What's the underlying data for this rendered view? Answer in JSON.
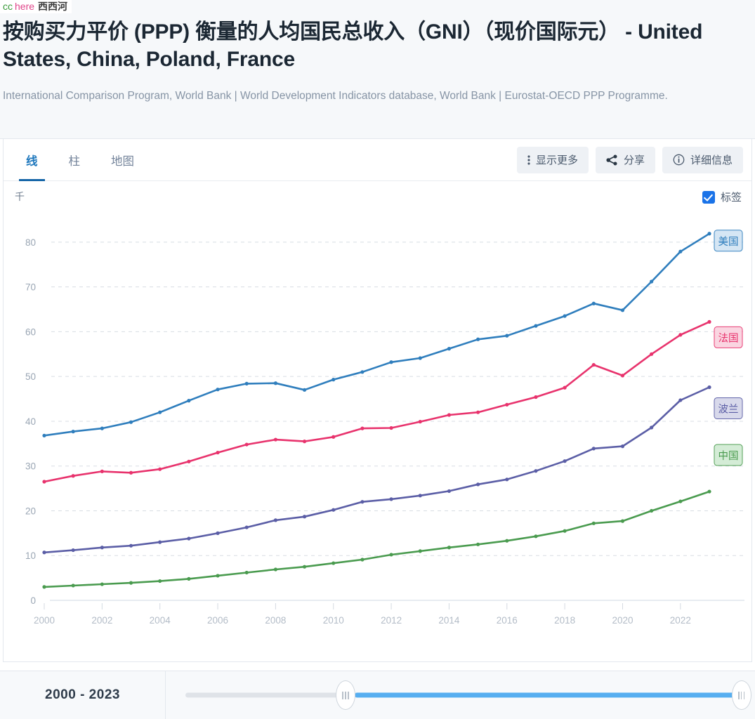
{
  "watermark": {
    "cc": "cc",
    "here": "here",
    "site": "西西河"
  },
  "header": {
    "title": "按购买力平价 (PPP) 衡量的人均国民总收入（GNI）（现价国际元） - United States, China, Poland, France",
    "subtitle": "International Comparison Program, World Bank | World Development Indicators database, World Bank | Eurostat-OECD PPP Programme."
  },
  "tabs": [
    {
      "label": "线",
      "active": true
    },
    {
      "label": "柱",
      "active": false
    },
    {
      "label": "地图",
      "active": false
    }
  ],
  "toolbar": {
    "show_more": "显示更多",
    "share": "分享",
    "details": "详细信息"
  },
  "chart_controls": {
    "labels_checkbox": "标签",
    "labels_checked": true,
    "unit": "千"
  },
  "footer": {
    "range_text": "2000 - 2023",
    "slider_start": 2000,
    "slider_end": 2023
  },
  "chart_data": {
    "type": "line",
    "title": "按购买力平价 (PPP) 衡量的人均国民总收入（GNI）（现价国际元）",
    "xlabel": "",
    "ylabel": "千",
    "ylim": [
      0,
      85
    ],
    "yticks": [
      0,
      10,
      20,
      30,
      40,
      50,
      60,
      70,
      80
    ],
    "xlim": [
      2000,
      2023
    ],
    "xticks": [
      2000,
      2002,
      2004,
      2006,
      2008,
      2010,
      2012,
      2014,
      2016,
      2018,
      2020,
      2022
    ],
    "grid": true,
    "legend_position": "line-end-labels",
    "x": [
      2000,
      2001,
      2002,
      2003,
      2004,
      2005,
      2006,
      2007,
      2008,
      2009,
      2010,
      2011,
      2012,
      2013,
      2014,
      2015,
      2016,
      2017,
      2018,
      2019,
      2020,
      2021,
      2022,
      2023
    ],
    "series": [
      {
        "name": "美国",
        "english": "United States",
        "color": "#2f7ebd",
        "label_bg": "#d3e5f4",
        "values": [
          36.8,
          37.7,
          38.4,
          39.8,
          42.0,
          44.6,
          47.1,
          48.4,
          48.5,
          47.0,
          49.3,
          51.0,
          53.2,
          54.1,
          56.2,
          58.3,
          59.1,
          61.3,
          63.5,
          66.3,
          64.8,
          71.2,
          77.9,
          81.9
        ]
      },
      {
        "name": "法国",
        "english": "France",
        "color": "#e8336d",
        "label_bg": "#fad3e0",
        "values": [
          26.5,
          27.8,
          28.8,
          28.5,
          29.3,
          31.0,
          33.0,
          34.8,
          35.9,
          35.5,
          36.5,
          38.4,
          38.5,
          39.9,
          41.4,
          42.0,
          43.7,
          45.4,
          47.5,
          52.6,
          50.2,
          55.0,
          59.3,
          62.2
        ]
      },
      {
        "name": "波兰",
        "english": "Poland",
        "color": "#5b5ea6",
        "label_bg": "#d6d8ea",
        "values": [
          10.7,
          11.2,
          11.8,
          12.2,
          13.0,
          13.8,
          15.0,
          16.3,
          17.9,
          18.7,
          20.2,
          22.0,
          22.6,
          23.4,
          24.4,
          25.9,
          27.0,
          28.9,
          31.1,
          33.9,
          34.4,
          38.6,
          44.7,
          47.6
        ]
      },
      {
        "name": "中国",
        "english": "China",
        "color": "#4a9b4f",
        "label_bg": "#d2ecd4",
        "values": [
          3.0,
          3.3,
          3.6,
          3.9,
          4.3,
          4.8,
          5.5,
          6.2,
          6.9,
          7.5,
          8.3,
          9.1,
          10.2,
          11.0,
          11.8,
          12.5,
          13.3,
          14.3,
          15.5,
          17.2,
          17.7,
          20.0,
          22.1,
          24.3
        ]
      }
    ]
  }
}
